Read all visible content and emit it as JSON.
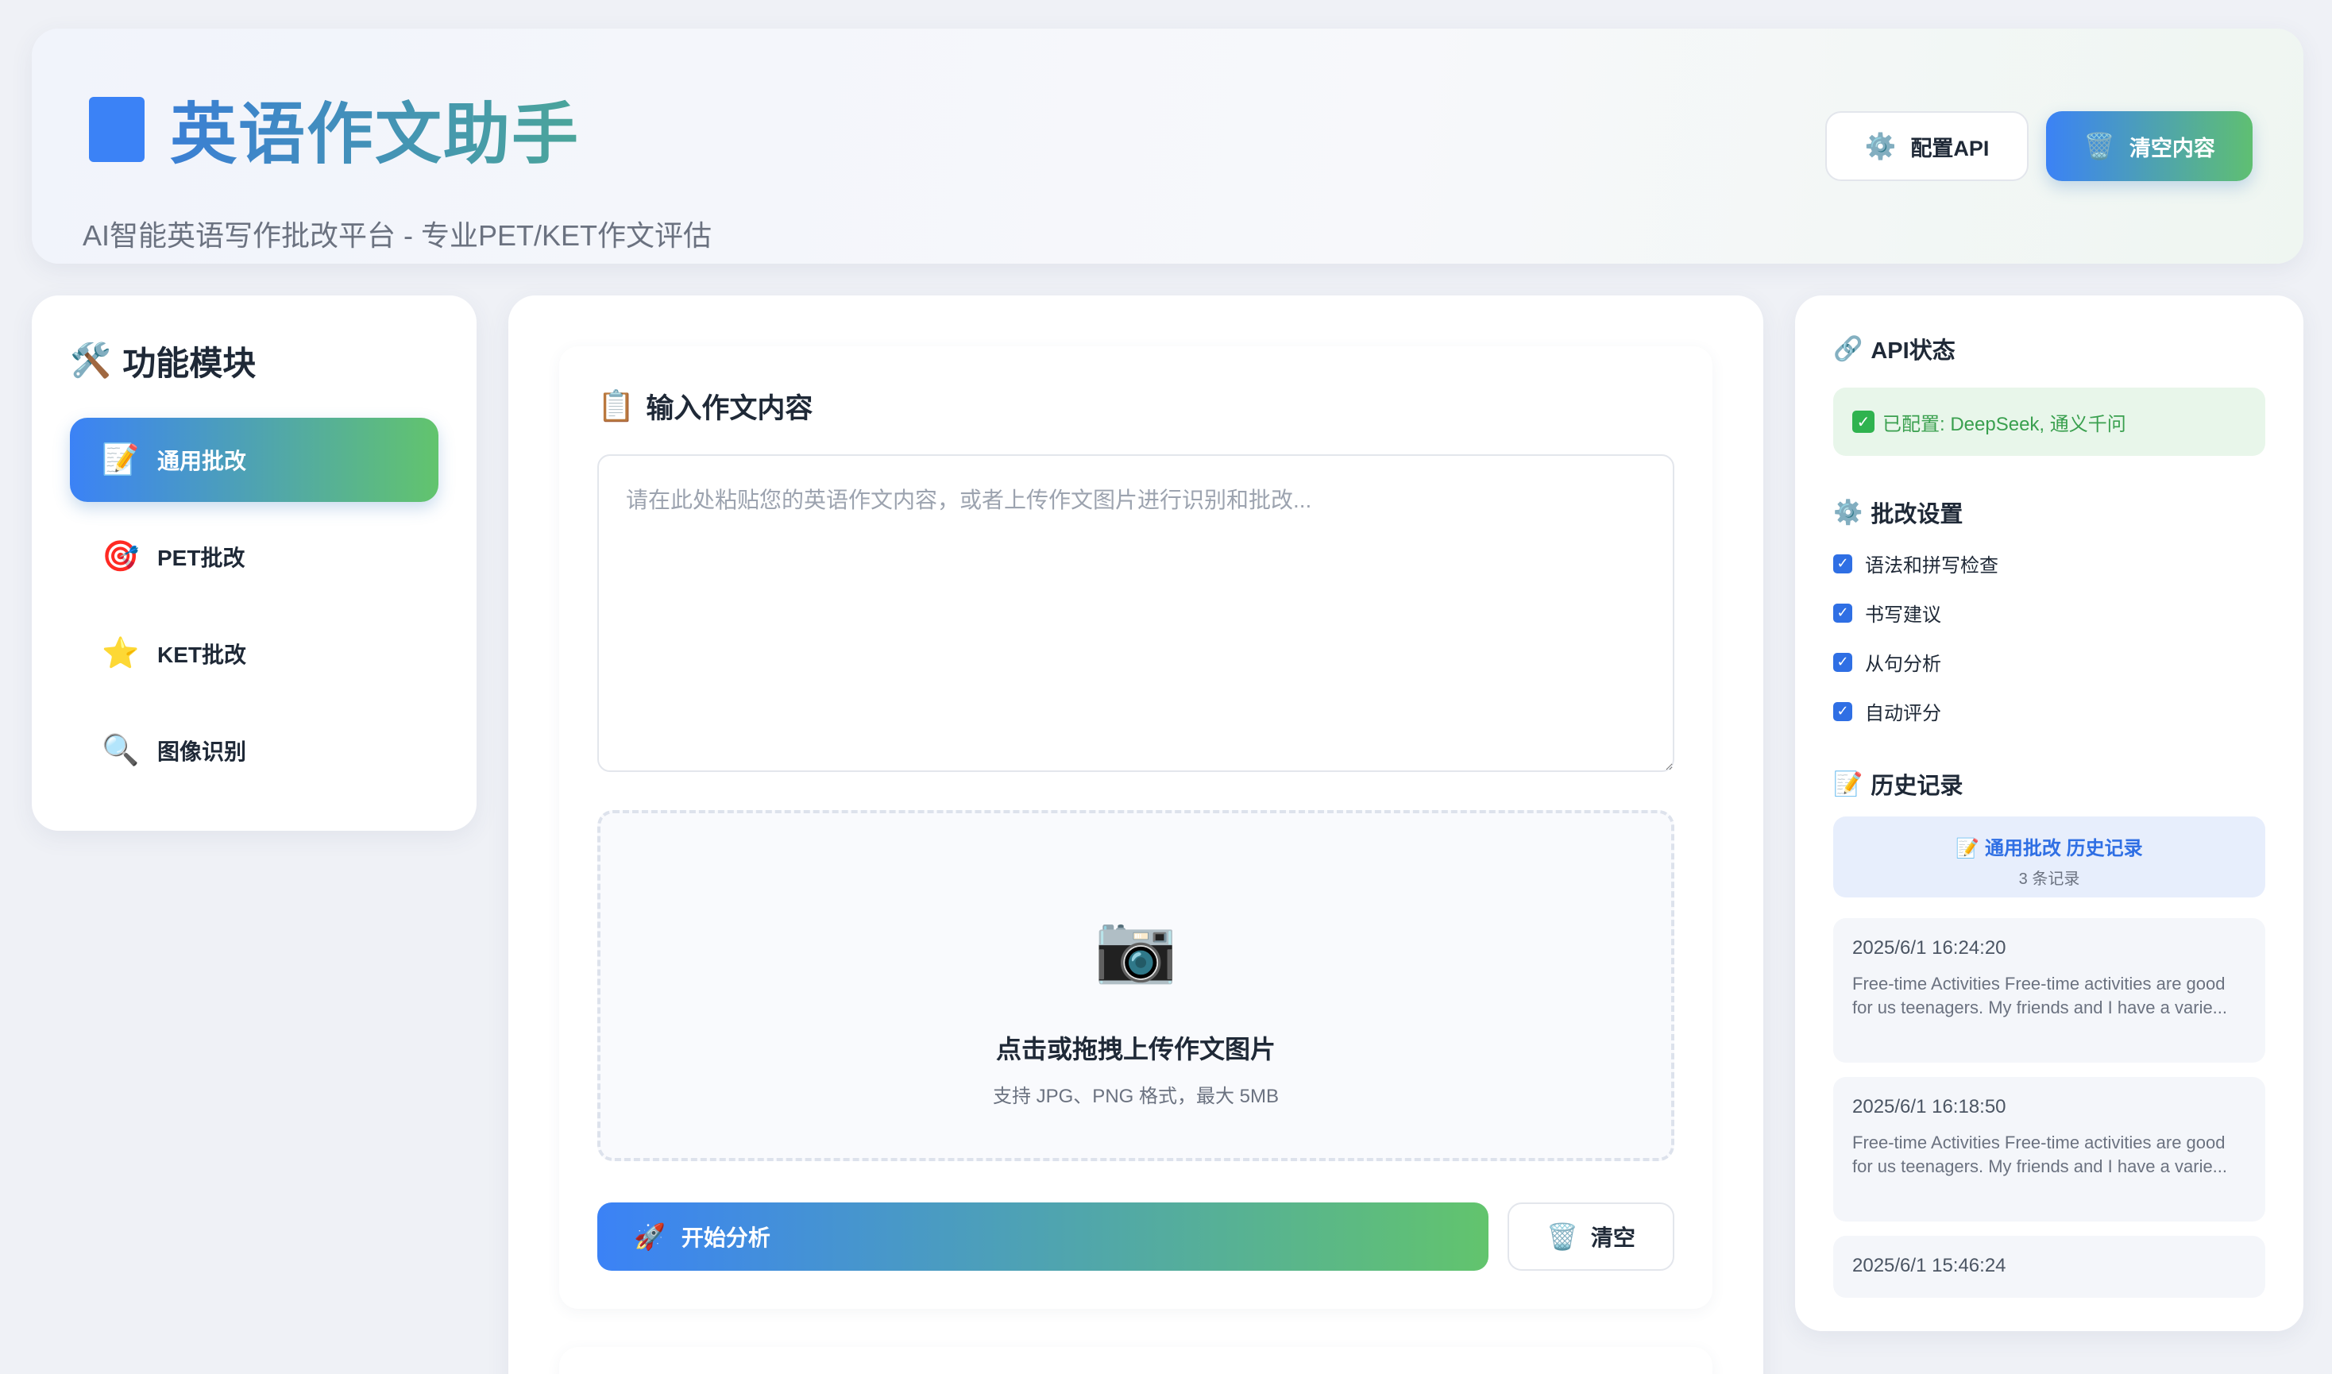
{
  "header": {
    "title": "英语作文助手",
    "subtitle": "AI智能英语写作批改平台 - 专业PET/KET作文评估",
    "config_api_label": "配置API",
    "config_api_icon": "gear-icon",
    "clear_all_label": "清空内容",
    "clear_all_icon": "trash-icon"
  },
  "sidebar": {
    "title": "功能模块",
    "title_icon": "tools-icon",
    "items": [
      {
        "label": "通用批改",
        "icon": "memo-icon",
        "active": true
      },
      {
        "label": "PET批改",
        "icon": "target-icon",
        "active": false
      },
      {
        "label": "KET批改",
        "icon": "star-icon",
        "active": false
      },
      {
        "label": "图像识别",
        "icon": "magnifier-icon",
        "active": false
      }
    ]
  },
  "main": {
    "input_title": "输入作文内容",
    "input_title_icon": "clipboard-icon",
    "textarea_value": "",
    "textarea_placeholder": "请在此处粘贴您的英语作文内容，或者上传作文图片进行识别和批改...",
    "upload": {
      "icon": "camera-icon",
      "title": "点击或拖拽上传作文图片",
      "hint": "支持 JPG、PNG 格式，最大 5MB"
    },
    "start_label": "开始分析",
    "start_icon": "rocket-icon",
    "clear_label": "清空",
    "clear_icon": "trash-icon"
  },
  "right": {
    "api_title": "API状态",
    "api_title_icon": "link-icon",
    "api_status": "已配置: DeepSeek, 通义千问",
    "settings_title": "批改设置",
    "settings_title_icon": "gear-icon",
    "settings": [
      {
        "label": "语法和拼写检查",
        "checked": true
      },
      {
        "label": "书写建议",
        "checked": true
      },
      {
        "label": "从句分析",
        "checked": true
      },
      {
        "label": "自动评分",
        "checked": true
      }
    ],
    "history_title": "历史记录",
    "history_title_icon": "memo-icon",
    "history_header": "通用批改 历史记录",
    "history_count": "3 条记录",
    "history": [
      {
        "time": "2025/6/1 16:24:20",
        "preview": "Free-time Activities Free-time activities are good for us teenagers. My friends and I have a varie..."
      },
      {
        "time": "2025/6/1 16:18:50",
        "preview": "Free-time Activities Free-time activities are good for us teenagers. My friends and I have a varie..."
      },
      {
        "time": "2025/6/1 15:46:24",
        "preview": ""
      }
    ]
  },
  "colors": {
    "accent_blue": "#3b82f6",
    "accent_green": "#62c46d",
    "status_green": "#3aa04f"
  }
}
